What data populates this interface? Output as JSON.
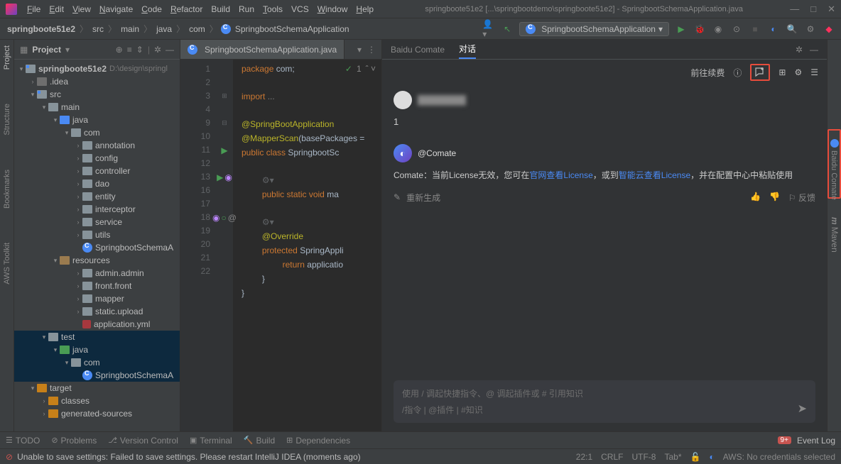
{
  "window": {
    "title": "springboote51e2 [...\\springbootdemo\\springboote51e2] - SpringbootSchemaApplication.java"
  },
  "menu": {
    "file": "File",
    "edit": "Edit",
    "view": "View",
    "navigate": "Navigate",
    "code": "Code",
    "refactor": "Refactor",
    "build": "Build",
    "run": "Run",
    "tools": "Tools",
    "vcs": "VCS",
    "window": "Window",
    "help": "Help"
  },
  "breadcrumb": {
    "root": "springboote51e2",
    "p1": "src",
    "p2": "main",
    "p3": "java",
    "p4": "com",
    "p5": "SpringbootSchemaApplication"
  },
  "runconfig": {
    "name": "SpringbootSchemaApplication"
  },
  "project_panel": {
    "title": "Project"
  },
  "tree": {
    "root": "springboote51e2",
    "root_path": "D:\\design\\springl",
    "idea": ".idea",
    "src": "src",
    "main": "main",
    "java": "java",
    "com": "com",
    "annotation": "annotation",
    "config": "config",
    "controller": "controller",
    "dao": "dao",
    "entity": "entity",
    "interceptor": "interceptor",
    "service": "service",
    "utils": "utils",
    "app": "SpringbootSchemaA",
    "resources": "resources",
    "admin": "admin.admin",
    "front": "front.front",
    "mapper": "mapper",
    "static_upload": "static.upload",
    "appyml": "application.yml",
    "test": "test",
    "java2": "java",
    "com2": "com",
    "app2": "SpringbootSchemaA",
    "target": "target",
    "classes": "classes",
    "gensrc": "generated-sources"
  },
  "editor": {
    "tab": "SpringbootSchemaApplication.java",
    "lines": [
      "1",
      "2",
      "3",
      "4",
      "9",
      "10",
      "11",
      "12",
      "13",
      "16",
      "17",
      "18",
      "19",
      "20",
      "21",
      "22"
    ],
    "l1_kw": "package ",
    "l1_id": "com",
    "l1_end": ";",
    "l3_kw": "import ",
    "l3_rest": "...",
    "l9": "@SpringBootApplication",
    "l10a": "@MapperScan",
    "l10b": "(basePackages =",
    "l11a": "public class ",
    "l11b": "SpringbootSc",
    "l13a": "public static void ",
    "l13b": "ma",
    "l17": "@Override",
    "l18a": "protected ",
    "l18b": "SpringAppli",
    "l19a": "return ",
    "l19b": "applicatio",
    "l20": "}",
    "l21": "}",
    "indicator_num": "1"
  },
  "comate": {
    "tab1": "Baidu Comate",
    "tab2": "对话",
    "renewal": "前往续费",
    "user_msg": "1",
    "bot_name": "@Comate",
    "bot_prefix": "Comate：当前License无效，您可在",
    "link1": "官网查看License",
    "mid": "，或到",
    "link2": "智能云查看License",
    "suffix": "，并在配置中心中粘贴使用",
    "regen": "重新生成",
    "feedback": "反馈",
    "input_hint": "使用 / 调起快捷指令、@ 调起插件或 # 引用知识",
    "tags": "/指令 | @插件 | #知识"
  },
  "right_panel": {
    "baidu": "Baidu Comate",
    "maven": "Maven"
  },
  "left_tabs": {
    "project": "Project",
    "structure": "Structure",
    "bookmarks": "Bookmarks",
    "aws": "AWS Toolkit"
  },
  "bottom": {
    "todo": "TODO",
    "problems": "Problems",
    "vc": "Version Control",
    "terminal": "Terminal",
    "build": "Build",
    "deps": "Dependencies",
    "eventlog": "Event Log",
    "event_badge": "9+"
  },
  "status": {
    "error": "Unable to save settings: Failed to save settings. Please restart IntelliJ IDEA (moments ago)",
    "pos": "22:1",
    "le": "CRLF",
    "enc": "UTF-8",
    "indent": "Tab*",
    "aws": "AWS: No credentials selected"
  }
}
